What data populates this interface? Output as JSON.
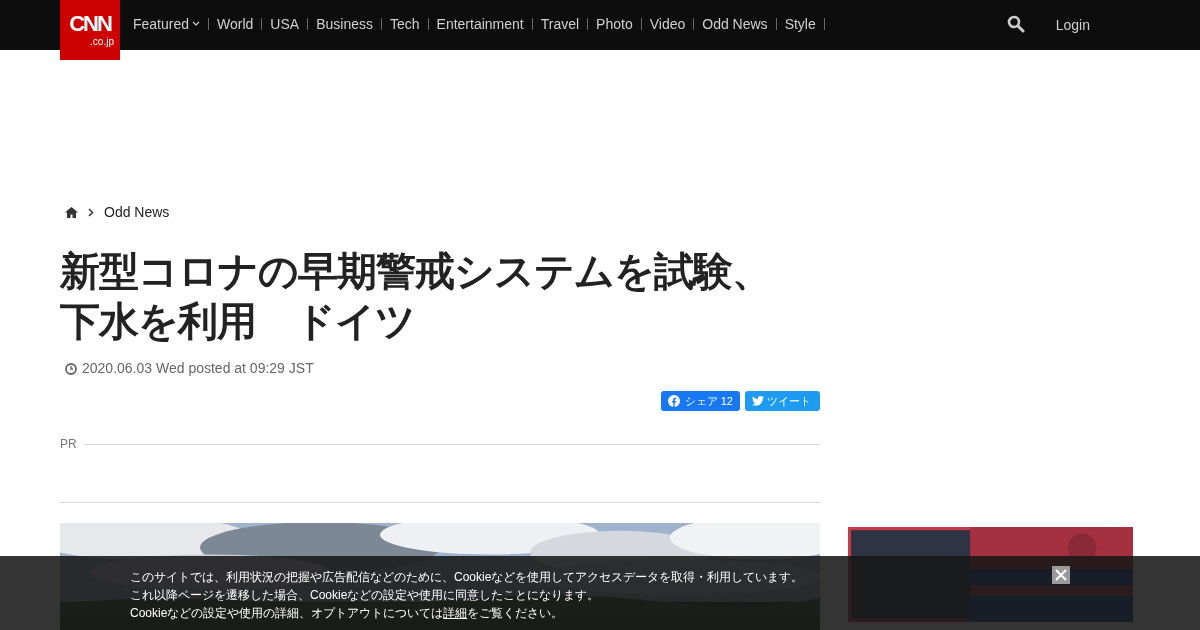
{
  "nav": {
    "logo": "CNN",
    "logo_sub": ".co.jp",
    "items": [
      {
        "label": "Featured",
        "dropdown": true
      },
      {
        "label": "World",
        "dropdown": false
      },
      {
        "label": "USA",
        "dropdown": false
      },
      {
        "label": "Business",
        "dropdown": false
      },
      {
        "label": "Tech",
        "dropdown": false
      },
      {
        "label": "Entertainment",
        "dropdown": false
      },
      {
        "label": "Travel",
        "dropdown": false
      },
      {
        "label": "Photo",
        "dropdown": false
      },
      {
        "label": "Video",
        "dropdown": false
      },
      {
        "label": "Odd News",
        "dropdown": false
      },
      {
        "label": "Style",
        "dropdown": false
      }
    ],
    "login": "Login"
  },
  "breadcrumb": [
    "Odd News"
  ],
  "article": {
    "title_lines": [
      "新型コロナの早期警戒システムを試験、",
      "下水を利用　ドイツ"
    ],
    "date": "2020.06.03 Wed posted at 09:29 JST",
    "share": [
      {
        "kind": "facebook",
        "label": "シェア",
        "count": "12"
      },
      {
        "kind": "twitter",
        "label": "ツイート"
      }
    ],
    "pr_label": "PR",
    "photo": {
      "kind": "picture"
    }
  },
  "topic_banner": {
    "kind": "picture"
  },
  "cookie_notice": {
    "lines": [
      "このサイトでは、利用状況の把握や広告配信などのために、Cookieなどを使用してアクセスデータを取得・利用しています。",
      "これ以降ページを遷移した場合、Cookieなどの設定や使用に同意したことになります。"
    ],
    "last_line_before": "Cookieなどの設定や使用の詳細、オプトアウトについては",
    "link": "詳細",
    "last_line_after": "をご覧ください。"
  }
}
